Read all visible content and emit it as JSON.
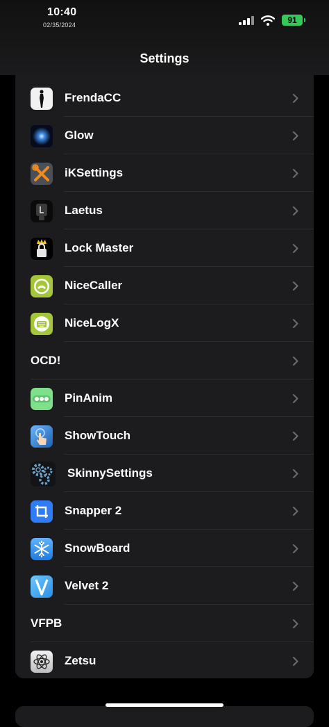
{
  "status_bar": {
    "time": "10:40",
    "date": "02/35/2024",
    "battery": "91"
  },
  "nav": {
    "title": "Settings"
  },
  "items": [
    {
      "label": "FrendaCC",
      "icon": "silhouette-icon"
    },
    {
      "label": "Glow",
      "icon": "glow-orb-icon"
    },
    {
      "label": "iKSettings",
      "icon": "tools-icon"
    },
    {
      "label": "Laetus",
      "icon": "laetus-icon"
    },
    {
      "label": "Lock Master",
      "icon": "crown-lock-icon"
    },
    {
      "label": "NiceCaller",
      "icon": "phone-icon"
    },
    {
      "label": "NiceLogX",
      "icon": "keyboard-icon"
    },
    {
      "label": "OCD!",
      "icon": ""
    },
    {
      "label": "PinAnim",
      "icon": "pin-dots-icon"
    },
    {
      "label": "ShowTouch",
      "icon": "touch-hand-icon"
    },
    {
      "label": "SkinnySettings",
      "icon": "gears-icon"
    },
    {
      "label": "Snapper 2",
      "icon": "crop-icon"
    },
    {
      "label": "SnowBoard",
      "icon": "snowflake-icon"
    },
    {
      "label": "Velvet 2",
      "icon": "velvet-icon"
    },
    {
      "label": "VFPB",
      "icon": ""
    },
    {
      "label": "Zetsu",
      "icon": "atom-icon"
    }
  ],
  "colors": {
    "accent": "#34c759",
    "row_bg": "#1c1c1e",
    "separator": "#2e2e31"
  }
}
